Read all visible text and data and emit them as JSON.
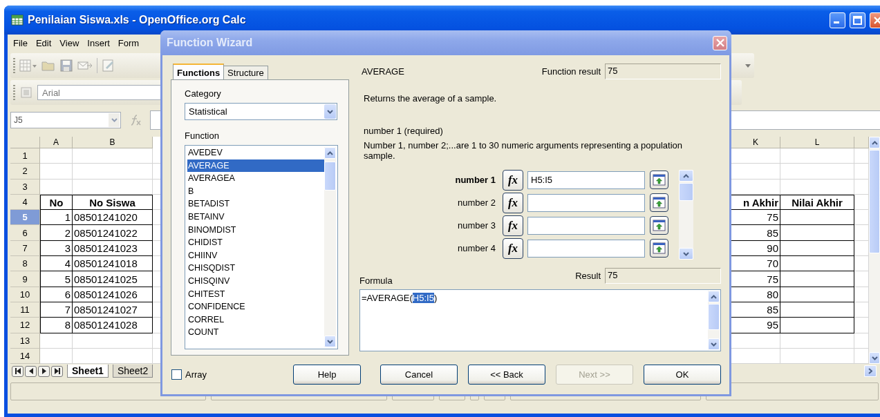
{
  "window": {
    "title": "Penilaian Siswa.xls - OpenOffice.org Calc"
  },
  "menu": [
    "File",
    "Edit",
    "View",
    "Insert",
    "Form"
  ],
  "toolbar": {
    "font_name": "Arial"
  },
  "formula_bar": {
    "cell_ref": "J5"
  },
  "sheet": {
    "columns": [
      {
        "label": "A"
      },
      {
        "label": "B"
      },
      {
        "label": "K"
      },
      {
        "label": "L"
      }
    ],
    "rows": [
      {
        "number": "1",
        "selected": false,
        "kind": "blank"
      },
      {
        "number": "2",
        "selected": false,
        "kind": "blank"
      },
      {
        "number": "3",
        "selected": false,
        "kind": "blank"
      },
      {
        "number": "4",
        "selected": false,
        "kind": "header",
        "no": "No",
        "no_siswa": "No Siswa",
        "column_k": "n Akhir",
        "nilai_akhir": "Nilai Akhir"
      },
      {
        "number": "5",
        "selected": true,
        "kind": "data",
        "no": "1",
        "no_siswa": "08501241020",
        "column_k": "75"
      },
      {
        "number": "6",
        "selected": false,
        "kind": "data",
        "no": "2",
        "no_siswa": "08501241022",
        "column_k": "85"
      },
      {
        "number": "7",
        "selected": false,
        "kind": "data",
        "no": "3",
        "no_siswa": "08501241023",
        "column_k": "90"
      },
      {
        "number": "8",
        "selected": false,
        "kind": "data",
        "no": "4",
        "no_siswa": "08501241018",
        "column_k": "70"
      },
      {
        "number": "9",
        "selected": false,
        "kind": "data",
        "no": "5",
        "no_siswa": "08501241025",
        "column_k": "75"
      },
      {
        "number": "10",
        "selected": false,
        "kind": "data",
        "no": "6",
        "no_siswa": "08501241026",
        "column_k": "80"
      },
      {
        "number": "11",
        "selected": false,
        "kind": "data",
        "no": "7",
        "no_siswa": "08501241027",
        "column_k": "85"
      },
      {
        "number": "12",
        "selected": false,
        "kind": "data",
        "no": "8",
        "no_siswa": "08501241028",
        "column_k": "95"
      },
      {
        "number": "13",
        "selected": false,
        "kind": "blank"
      },
      {
        "number": "14",
        "selected": false,
        "kind": "blank"
      }
    ]
  },
  "sheet_tabs": [
    {
      "label": "Sheet1",
      "selected": true
    },
    {
      "label": "Sheet2",
      "selected": false
    }
  ],
  "dialog": {
    "title": "Function Wizard",
    "tabs": [
      {
        "label": "Functions",
        "selected": true
      },
      {
        "label": "Structure",
        "selected": false
      }
    ],
    "category_label": "Category",
    "category": "Statistical",
    "function_label": "Function",
    "functions": [
      {
        "label": "AVEDEV",
        "selected": false
      },
      {
        "label": "AVERAGE",
        "selected": true
      },
      {
        "label": "AVERAGEA",
        "selected": false
      },
      {
        "label": "B",
        "selected": false
      },
      {
        "label": "BETADIST",
        "selected": false
      },
      {
        "label": "BETAINV",
        "selected": false
      },
      {
        "label": "BINOMDIST",
        "selected": false
      },
      {
        "label": "CHIDIST",
        "selected": false
      },
      {
        "label": "CHIINV",
        "selected": false
      },
      {
        "label": "CHISQDIST",
        "selected": false
      },
      {
        "label": "CHISQINV",
        "selected": false
      },
      {
        "label": "CHITEST",
        "selected": false
      },
      {
        "label": "CONFIDENCE",
        "selected": false
      },
      {
        "label": "CORREL",
        "selected": false
      },
      {
        "label": "COUNT",
        "selected": false
      }
    ],
    "array": {
      "label": "Array",
      "checked": false
    },
    "function_name": "AVERAGE",
    "function_result_label": "Function result",
    "function_result": "75",
    "description": "Returns the average of a sample.",
    "argument_title": "number 1 (required)",
    "argument_description": "Number 1, number 2;...are 1 to 30 numeric arguments representing a population sample.",
    "arguments": [
      {
        "label": "number 1",
        "button": "fx",
        "value": "H5:I5",
        "active": true
      },
      {
        "label": "number 2",
        "button": "fx",
        "active": false
      },
      {
        "label": "number 3",
        "button": "fx",
        "active": false
      },
      {
        "label": "number 4",
        "button": "fx",
        "active": false
      }
    ],
    "formula_label": "Formula",
    "result_label": "Result",
    "result": "75",
    "formula": [
      {
        "text": "=AVERAGE(",
        "selected": false
      },
      {
        "text": "H5:I5",
        "selected": true
      },
      {
        "text": ")",
        "selected": false
      }
    ],
    "buttons": [
      {
        "label": "Help",
        "disabled": false
      },
      {
        "label": "Cancel",
        "disabled": false
      },
      {
        "label": "<< Back",
        "disabled": false
      },
      {
        "label": "Next >>",
        "disabled": true
      },
      {
        "label": "OK",
        "disabled": false
      }
    ]
  }
}
